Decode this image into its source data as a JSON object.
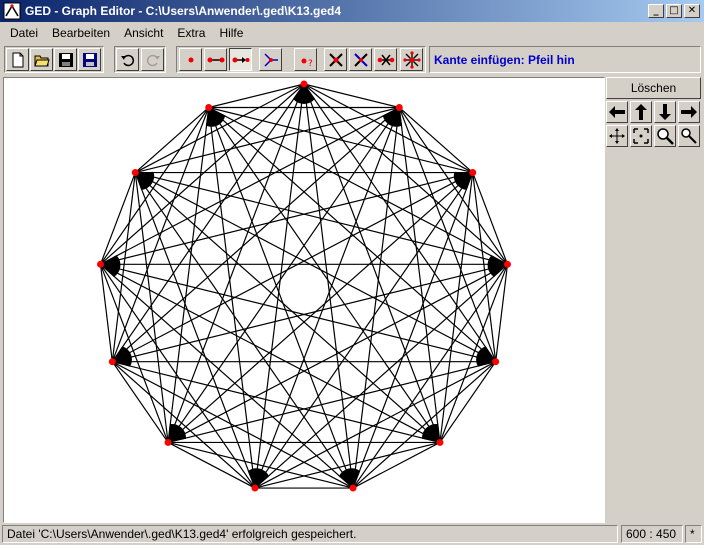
{
  "window": {
    "title": "GED - Graph Editor - C:\\Users\\Anwender\\.ged\\K13.ged4",
    "minimize": "_",
    "maximize": "□",
    "close": "✕"
  },
  "menu": [
    {
      "label": "Datei"
    },
    {
      "label": "Bearbeiten"
    },
    {
      "label": "Ansicht"
    },
    {
      "label": "Extra"
    },
    {
      "label": "Hilfe"
    }
  ],
  "toolbar": {
    "file_buttons": [
      {
        "name": "new-icon"
      },
      {
        "name": "open-folder-icon"
      },
      {
        "name": "save-icon"
      },
      {
        "name": "save-as-icon"
      }
    ],
    "history_buttons": [
      {
        "name": "undo-icon"
      },
      {
        "name": "redo-icon"
      }
    ],
    "tool_buttons": [
      {
        "name": "add-node-icon"
      },
      {
        "name": "add-edge-icon"
      },
      {
        "name": "add-arrow-edge-icon"
      },
      {
        "name": "move-node-icon"
      },
      {
        "name": "node-properties-icon"
      },
      {
        "name": "delete-node-icon"
      },
      {
        "name": "delete-edge-icon"
      },
      {
        "name": "split-edge-icon"
      },
      {
        "name": "explode-node-icon"
      }
    ],
    "mode_label": "Kante einfügen: Pfeil hin"
  },
  "side_panel": {
    "delete_label": "Löschen",
    "nav_buttons": [
      {
        "name": "arrow-left-icon",
        "glyph": "⬅"
      },
      {
        "name": "arrow-up-icon",
        "glyph": "⬆"
      },
      {
        "name": "arrow-down-icon",
        "glyph": "⬇"
      },
      {
        "name": "arrow-right-icon",
        "glyph": "➡"
      },
      {
        "name": "expand-icon"
      },
      {
        "name": "fit-icon"
      },
      {
        "name": "zoom-in-icon"
      },
      {
        "name": "zoom-out-icon"
      }
    ]
  },
  "graph": {
    "nodes": 13,
    "complete": true,
    "node_color": "#ff0000",
    "edge_color": "#000000"
  },
  "status": {
    "message": "Datei 'C:\\Users\\Anwender\\.ged\\K13.ged4' erfolgreich gespeichert.",
    "coords": "600 : 450",
    "modified": "*"
  },
  "colors": {
    "title_start": "#0a246a",
    "title_end": "#a6caf0",
    "face": "#d4d0c8",
    "accent_text": "#0000cc"
  }
}
